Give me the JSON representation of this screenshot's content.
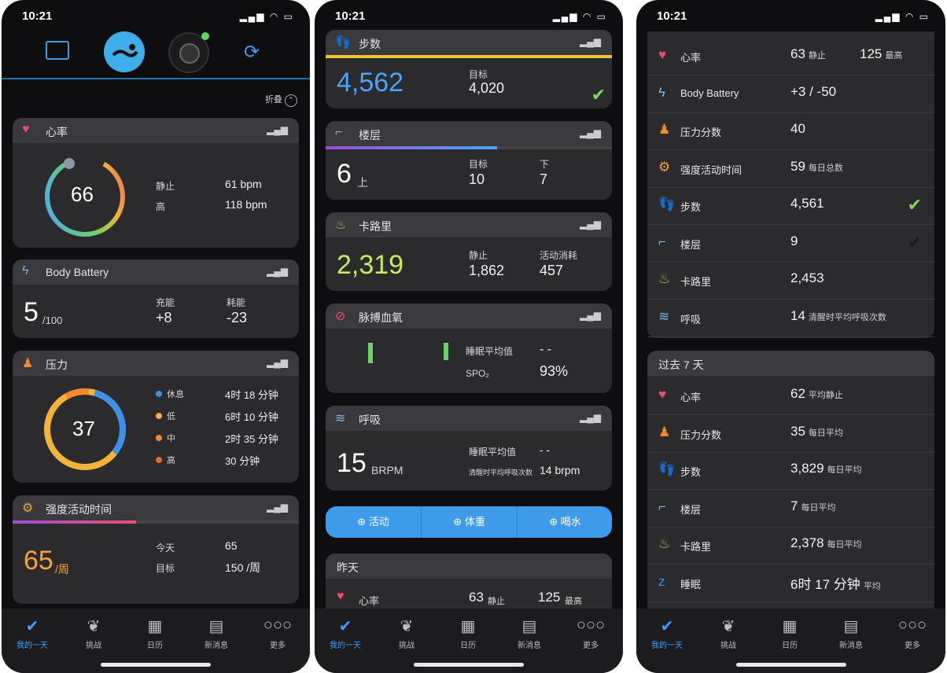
{
  "p1": {
    "time": "10:21",
    "collapse": "折叠",
    "heart": {
      "title": "心率",
      "value": "66",
      "rest_label": "静止",
      "rest_val": "61 bpm",
      "high_label": "高",
      "high_val": "118 bpm"
    },
    "battery": {
      "title": "Body Battery",
      "value": "5",
      "unit": "/100",
      "charge_label": "充能",
      "charge_val": "+8",
      "drain_label": "耗能",
      "drain_val": "-23"
    },
    "stress": {
      "title": "压力",
      "value": "37",
      "levels": [
        {
          "label": "休息",
          "val": "4时 18 分钟",
          "color": "#3d8fe8"
        },
        {
          "label": "低",
          "val": "6时 10 分钟",
          "color": "#f1b33a"
        },
        {
          "label": "中",
          "val": "2时 35 分钟",
          "color": "#f08a2a"
        },
        {
          "label": "高",
          "val": "30 分钟",
          "color": "#e26a22"
        }
      ]
    },
    "intensity": {
      "title": "强度活动时间",
      "value": "65",
      "unit": "/周",
      "today_label": "今天",
      "today_val": "65",
      "goal_label": "目标",
      "goal_val": "150 /周",
      "progress": 0.43
    }
  },
  "p2": {
    "time": "10:21",
    "steps": {
      "title": "步数",
      "value": "4,562",
      "goal_label": "目标",
      "goal_val": "4,020"
    },
    "floors": {
      "title": "楼层",
      "value": "6",
      "unit": "上",
      "goal_label": "目标",
      "goal_val": "10",
      "down_label": "下",
      "down_val": "7",
      "progress": 0.6
    },
    "calories": {
      "title": "卡路里",
      "value": "2,319",
      "rest_label": "静止",
      "rest_val": "1,862",
      "active_label": "活动消耗",
      "active_val": "457"
    },
    "spo2": {
      "title": "脉搏血氧",
      "sleep_label": "睡眠平均值",
      "sleep_val": "- -",
      "spo2_label": "SPO₂",
      "spo2_val": "93%"
    },
    "resp": {
      "title": "呼吸",
      "value": "15",
      "unit": "BRPM",
      "sleep_label": "睡眠平均值",
      "sleep_val": "- -",
      "awake_label": "清醒时平均呼吸次数",
      "awake_val": "14 brpm"
    },
    "quick": [
      "活动",
      "体重",
      "喝水"
    ],
    "yesterday": {
      "title": "昨天",
      "heart_label": "心率",
      "rest_val": "63",
      "rest_unit": "静止",
      "high_val": "125",
      "high_unit": "最高"
    }
  },
  "p3": {
    "time": "10:21",
    "yesterday_rows": [
      {
        "icon": "heart",
        "label": "心率",
        "val": "63",
        "unit": "静止",
        "val2": "125",
        "unit2": "最高",
        "color": "#e8506e"
      },
      {
        "icon": "battery",
        "label": "Body Battery",
        "val": "+3 / -50",
        "unit": "",
        "color": "#7fb7e6"
      },
      {
        "icon": "stress",
        "label": "压力分数",
        "val": "40",
        "unit": "",
        "color": "#f08a2a"
      },
      {
        "icon": "intensity",
        "label": "强度活动时间",
        "val": "59",
        "unit": "每日总数",
        "color": "#f1a53a"
      },
      {
        "icon": "steps",
        "label": "步数",
        "val": "4,561",
        "unit": "",
        "color": "#3d8fe8",
        "check": "green"
      },
      {
        "icon": "floors",
        "label": "楼层",
        "val": "9",
        "unit": "",
        "color": "#7fb7e6",
        "check": "dark"
      },
      {
        "icon": "calories",
        "label": "卡路里",
        "val": "2,453",
        "unit": "",
        "color": "#8ed04a"
      },
      {
        "icon": "resp",
        "label": "呼吸",
        "val": "14",
        "unit": "清醒时平均呼吸次数",
        "color": "#7fb7e6"
      }
    ],
    "week_title": "过去 7 天",
    "week_rows": [
      {
        "icon": "heart",
        "label": "心率",
        "val": "62",
        "unit": "平均静止",
        "color": "#e8506e"
      },
      {
        "icon": "stress",
        "label": "压力分数",
        "val": "35",
        "unit": "每日平均",
        "color": "#f08a2a"
      },
      {
        "icon": "steps",
        "label": "步数",
        "val": "3,829",
        "unit": "每日平均",
        "color": "#3d8fe8"
      },
      {
        "icon": "floors",
        "label": "楼层",
        "val": "7",
        "unit": "每日平均",
        "color": "#7fb7e6"
      },
      {
        "icon": "calories",
        "label": "卡路里",
        "val": "2,378",
        "unit": "每日平均",
        "color": "#8ed04a"
      },
      {
        "icon": "sleep",
        "label": "睡眠",
        "val": "6时 17 分钟",
        "unit": "平均",
        "color": "#3d8fe8"
      }
    ]
  },
  "nav": [
    "我的一天",
    "挑战",
    "日历",
    "新消息",
    "更多"
  ],
  "colors": {
    "accent": "#3fa0ff",
    "steps": "#4aa3ff",
    "calories": "#c5ec62",
    "intensity": "#f1a53a"
  }
}
